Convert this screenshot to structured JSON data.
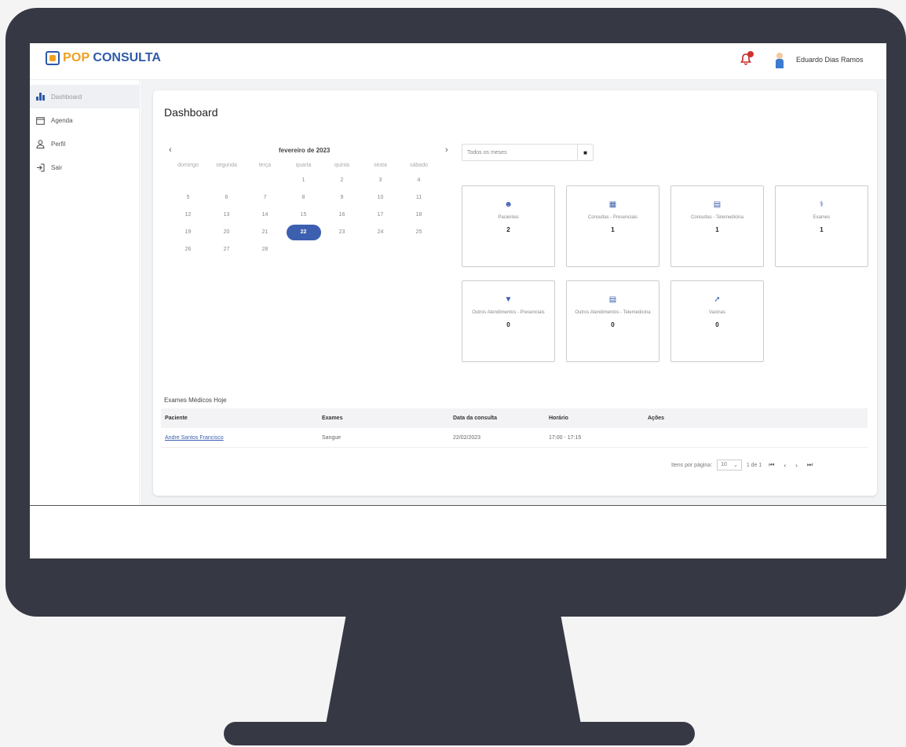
{
  "app": {
    "logo_pop": "POP",
    "logo_consulta": "CONSULTA",
    "user_name": "Eduardo Dias Ramos"
  },
  "sidebar": {
    "items": [
      {
        "label": "Dashboard",
        "icon": "bar-chart-icon"
      },
      {
        "label": "Agenda",
        "icon": "calendar-icon"
      },
      {
        "label": "Perfil",
        "icon": "user-icon"
      },
      {
        "label": "Sair",
        "icon": "logout-icon"
      }
    ]
  },
  "page": {
    "title": "Dashboard"
  },
  "calendar": {
    "title": "fevereiro de 2023",
    "weekdays": [
      "domingo",
      "segunda",
      "terça",
      "quarta",
      "quinta",
      "sexta",
      "sábado"
    ],
    "selected_day": "22",
    "weeks": [
      [
        "",
        "",
        "",
        "1",
        "2",
        "3",
        "4"
      ],
      [
        "5",
        "6",
        "7",
        "8",
        "9",
        "10",
        "11"
      ],
      [
        "12",
        "13",
        "14",
        "15",
        "16",
        "17",
        "18"
      ],
      [
        "19",
        "20",
        "21",
        "22",
        "23",
        "24",
        "25"
      ],
      [
        "26",
        "27",
        "28",
        "",
        "",
        "",
        ""
      ]
    ]
  },
  "month_filter": {
    "value": "Todos os meses"
  },
  "stats": [
    {
      "label": "Pacientes",
      "value": "2",
      "icon": "user-icon"
    },
    {
      "label": "Consultas - Presenciais",
      "value": "1",
      "icon": "calendar-icon"
    },
    {
      "label": "Consultas - Telemedicina",
      "value": "1",
      "icon": "monitor-icon"
    },
    {
      "label": "Exames",
      "value": "1",
      "icon": "stethoscope-icon"
    },
    {
      "label": "Outros Atendimentos - Presenciais",
      "value": "0",
      "icon": "tooth-icon"
    },
    {
      "label": "Outros Atendimentos - Telemedicina",
      "value": "0",
      "icon": "monitor-icon"
    },
    {
      "label": "Vacinas",
      "value": "0",
      "icon": "syringe-icon"
    }
  ],
  "table": {
    "title": "Exames Médicos Hoje",
    "headers": [
      "Paciente",
      "Exames",
      "Data da consulta",
      "Horário",
      "Ações"
    ],
    "rows": [
      {
        "patient": "Andre Santos Francisco",
        "exam": "Sangue",
        "date": "22/02/2023",
        "time": "17:00 - 17:15"
      }
    ]
  },
  "pagination": {
    "items_per_page_label": "Itens por página:",
    "items_per_page": "10",
    "range": "1 de 1"
  }
}
